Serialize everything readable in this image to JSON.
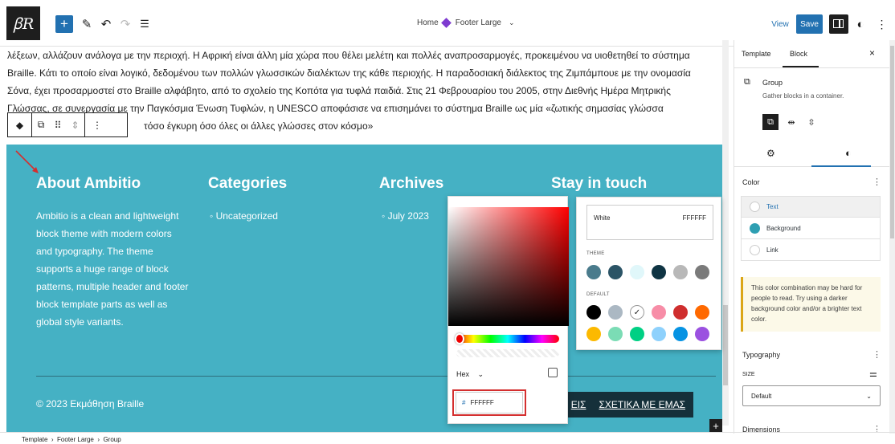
{
  "topbar": {
    "logo": "ꞵR",
    "breadcrumb_home": "Home",
    "breadcrumb_page": "Footer Large",
    "view_label": "View",
    "save_label": "Save"
  },
  "content": {
    "paragraph_line1": "λέξεων, αλλάζουν ανάλογα με την περιοχή. Η Αφρική είναι άλλη μία χώρα που θέλει μελέτη και πολλές αναπροσαρμογές, προκειμένου να υιοθετηθεί το σύστημα",
    "paragraph_line2": "Braille. Κάτι το οποίο είναι λογικό, δεδομένου των πολλών γλωσσικών διαλέκτων της κάθε περιοχής. Η παραδοσιακή διάλεκτος της Ζιμπάμπουε με την ονομασία",
    "paragraph_line3": "Σόνα, έχει προσαρμοστεί στο Braille αλφάβητο, από το σχολείο της Κοπότα για τυφλά παιδιά. Στις 21 Φεβρουαρίου του 2005, στην Διεθνής Ημέρα Μητρικής",
    "paragraph_line4": "Γλώσσας, σε συνεργασία με την Παγκόσμια Ένωση Τυφλών, η UNESCO αποφάσισε να επισημάνει το σύστημα Braille ως μία «ζωτικής σημασίας γλώσσα",
    "paragraph_line5_fragment": "τόσο έγκυρη όσο όλες οι άλλες γλώσσες στον κόσμο»"
  },
  "footer": {
    "about_heading": "About Ambitio",
    "about_text": "Ambitio is a clean and lightweight block theme with modern colors and typography. The theme supports a huge range of block patterns, multiple header and footer block template parts as well as global style variants.",
    "categories_heading": "Categories",
    "categories_item": "Uncategorized",
    "archives_heading": "Archives",
    "archives_item": "July 2023",
    "stay_heading": "Stay in touch",
    "copyright": "© 2023 Εκμάθηση Braille",
    "menu_item1": "ΕΙΣ",
    "menu_item2": "ΣΧΕΤΙΚΑ ΜΕ ΕΜΑΣ"
  },
  "picker": {
    "format_label": "Hex",
    "hash": "#",
    "hex_value": "FFFFFF",
    "red": "#ff0000"
  },
  "palette": {
    "current_name": "White",
    "current_value": "FFFFFF",
    "theme_label": "THEME",
    "default_label": "DEFAULT",
    "theme_colors": [
      "#4a7b8c",
      "#2b5466",
      "#e0f7fa",
      "#0f3443",
      "#b8b8b8",
      "#7a7a7a"
    ],
    "default_colors_row1": [
      "#000000",
      "#abb8c3",
      "#ffffff",
      "#f78da7",
      "#cf2e2e",
      "#ff6900"
    ],
    "default_colors_row2": [
      "#fcb900",
      "#7bdcb5",
      "#00d084",
      "#8ed1fc",
      "#0693e3",
      "#9b51e0"
    ]
  },
  "sidebar": {
    "tab_template": "Template",
    "tab_block": "Block",
    "close": "×",
    "block_name": "Group",
    "block_desc": "Gather blocks in a container.",
    "color_heading": "Color",
    "color_text": "Text",
    "color_background": "Background",
    "color_link": "Link",
    "background_swatch": "#2e9fb2",
    "notice": "This color combination may be hard for people to read. Try using a darker background color and/or a brighter text color.",
    "typography_heading": "Typography",
    "size_label": "SIZE",
    "size_value": "Default",
    "dimensions_heading": "Dimensions"
  },
  "bottom_breadcrumb": {
    "item1": "Template",
    "item2": "Footer Large",
    "item3": "Group"
  }
}
